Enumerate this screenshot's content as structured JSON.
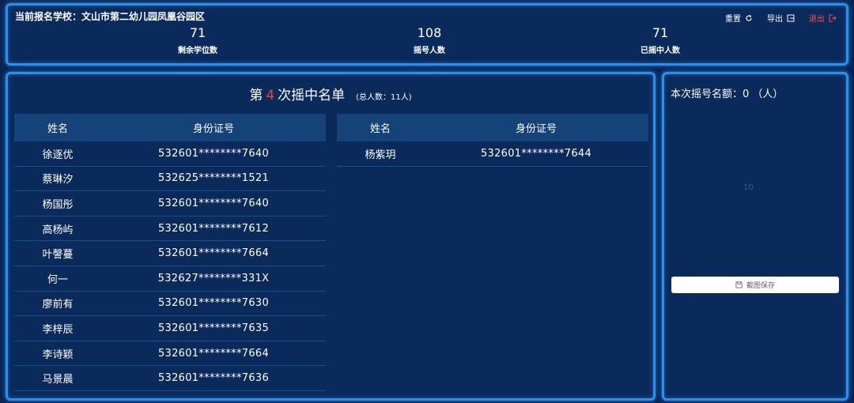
{
  "header": {
    "school_label": "当前报名学校：",
    "school_name": "文山市第二幼儿园凤凰谷园区",
    "actions": {
      "reset": "重置",
      "export": "导出",
      "logout": "退出"
    },
    "stats": [
      {
        "value": "71",
        "label": "剩余学位数"
      },
      {
        "value": "108",
        "label": "摇号人数"
      },
      {
        "value": "71",
        "label": "已摇中人数"
      }
    ]
  },
  "list": {
    "title_prefix": "第",
    "round": "4",
    "title_suffix": "次摇中名单",
    "total": "(总人数：11人)",
    "columns": {
      "name": "姓名",
      "id": "身份证号"
    },
    "left_rows": [
      {
        "name": "徐逐优",
        "id": "532601********7640"
      },
      {
        "name": "蔡琳汐",
        "id": "532625********1521"
      },
      {
        "name": "杨国彤",
        "id": "532601********7640"
      },
      {
        "name": "高杨屿",
        "id": "532601********7612"
      },
      {
        "name": "叶謦蔓",
        "id": "532601********7664"
      },
      {
        "name": "何一",
        "id": "532627********331X"
      },
      {
        "name": "廖前有",
        "id": "532601********7630"
      },
      {
        "name": "李梓辰",
        "id": "532601********7635"
      },
      {
        "name": "李诗颖",
        "id": "532601********7664"
      },
      {
        "name": "马景晨",
        "id": "532601********7636"
      }
    ],
    "right_rows": [
      {
        "name": "杨紫玥",
        "id": "532601********7644"
      }
    ]
  },
  "side": {
    "quota_label": "本次摇号名额：0 （人）",
    "mark": "10",
    "save_label": "截图保存"
  },
  "colors": {
    "accent_red": "#ff3b3b",
    "border_blue": "#2f8fe6",
    "panel_bg": "#0b2a5c"
  }
}
